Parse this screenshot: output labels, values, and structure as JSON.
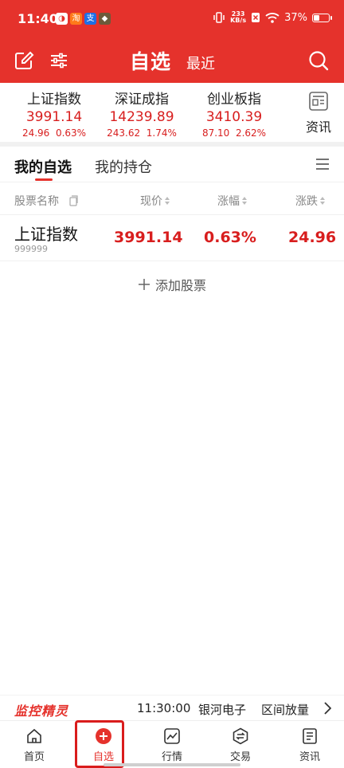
{
  "status_bar": {
    "time": "11:40",
    "net_speed_value": "233",
    "net_speed_unit": "KB/s",
    "battery_level": 0.37,
    "battery_text": "37%"
  },
  "header": {
    "title": "自选",
    "subtitle": "最近"
  },
  "indices": [
    {
      "name": "上证指数",
      "value": "3991.14",
      "change": "24.96",
      "pct": "0.63%"
    },
    {
      "name": "深证成指",
      "value": "14239.89",
      "change": "243.62",
      "pct": "1.74%"
    },
    {
      "name": "创业板指",
      "value": "3410.39",
      "change": "87.10",
      "pct": "2.62%"
    }
  ],
  "news_button": {
    "label": "资讯"
  },
  "tabs": [
    {
      "label": "我的自选",
      "active": true
    },
    {
      "label": "我的持仓",
      "active": false
    }
  ],
  "table": {
    "headers": {
      "name": "股票名称",
      "price": "现价",
      "pct": "涨幅",
      "change": "涨跌"
    },
    "rows": [
      {
        "name": "上证指数",
        "code": "999999",
        "price": "3991.14",
        "pct": "0.63%",
        "change": "24.96"
      }
    ]
  },
  "add_stock": {
    "label": "添加股票"
  },
  "ticker": {
    "brand": "监控精灵",
    "time": "11:30:00",
    "stock": "银河电子",
    "event": "区间放量"
  },
  "bottom_nav": [
    {
      "label": "首页",
      "icon": "home-icon"
    },
    {
      "label": "自选",
      "icon": "plus-circle-icon",
      "active": true
    },
    {
      "label": "行情",
      "icon": "chart-icon"
    },
    {
      "label": "交易",
      "icon": "exchange-icon"
    },
    {
      "label": "资讯",
      "icon": "news-icon"
    }
  ],
  "colors": {
    "brand_red": "#e5322c",
    "up_red": "#d81e1e"
  }
}
